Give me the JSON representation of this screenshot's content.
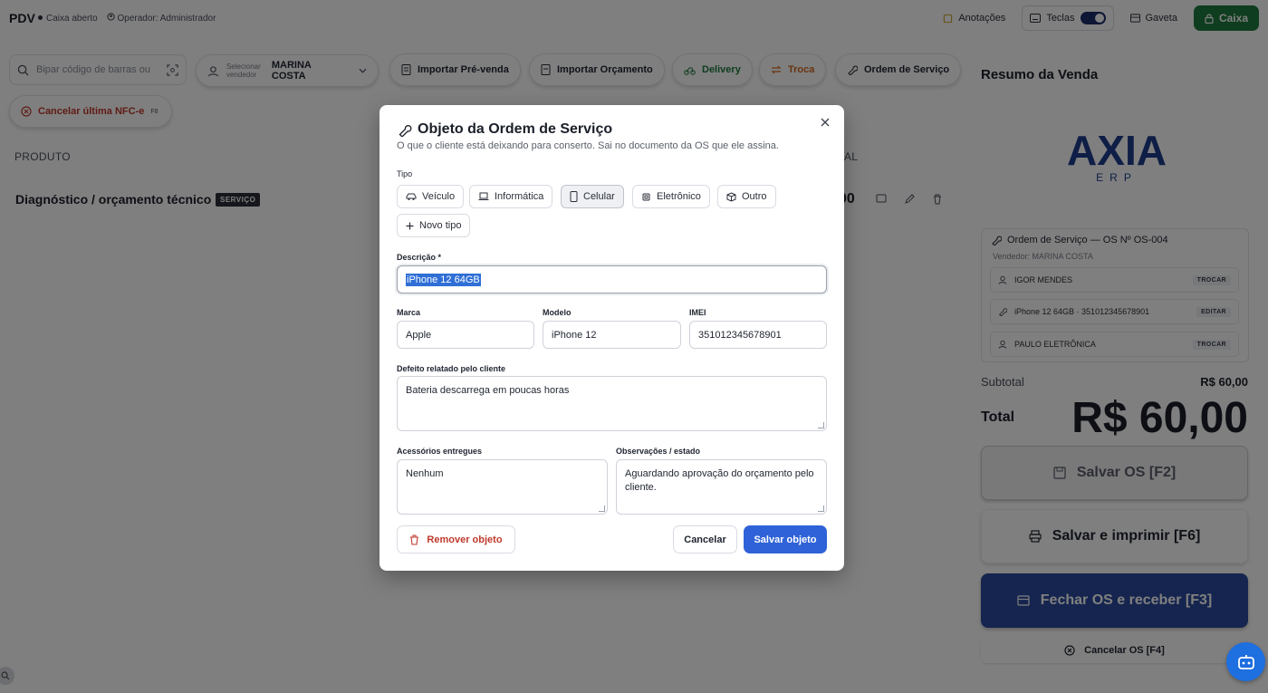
{
  "topbar": {
    "brand": "PDV",
    "status": "Caixa aberto",
    "operator": "Operador: Administrador",
    "notes": "Anotações",
    "keys": "Teclas",
    "drawer": "Gaveta",
    "register": "Caixa"
  },
  "actions": {
    "search_placeholder": "Bipar código de barras ou",
    "seller_label": "Selecionar vendedor",
    "seller_name": "MARINA COSTA",
    "import_presale": "Importar Pré-venda",
    "import_quote": "Importar Orçamento",
    "delivery": "Delivery",
    "exchange": "Troca",
    "service_order": "Ordem de Serviço",
    "cancel_nfce": "Cancelar última NFC-e",
    "cancel_nfce_key": "F8"
  },
  "table": {
    "col_product": "PRODUTO",
    "col_total_partial": "AL",
    "item_name": "Diagnóstico / orçamento técnico",
    "item_badge": "SERVIÇO",
    "item_value_partial": "00"
  },
  "summary": {
    "title": "Resumo da Venda",
    "logo_main": "AXIA",
    "logo_sub": "ERP",
    "os_title": "Ordem de Serviço — OS Nº OS-004",
    "os_seller": "Vendedor: MARINA COSTA",
    "rows": [
      {
        "text": "IGOR MENDES",
        "action": "TROCAR"
      },
      {
        "text": "iPhone 12 64GB · 351012345678901",
        "action": "EDITAR"
      },
      {
        "text": "PAULO ELETRÔNICA",
        "action": "TROCAR"
      }
    ],
    "subtotal_label": "Subtotal",
    "subtotal_value": "R$ 60,00",
    "total_label": "Total",
    "total_value": "R$ 60,00",
    "save_os": "Salvar OS [F2]",
    "save_print": "Salvar e imprimir [F6]",
    "close_os": "Fechar OS e receber [F3]",
    "cancel_os": "Cancelar OS [F4]"
  },
  "modal": {
    "title": "Objeto da Ordem de Serviço",
    "subtitle": "O que o cliente está deixando para conserto. Sai no documento da OS que ele assina.",
    "type_label": "Tipo",
    "types": [
      "Veículo",
      "Informática",
      "Celular",
      "Eletrônico",
      "Outro"
    ],
    "active_type": "Celular",
    "new_type": "Novo tipo",
    "description_label": "Descrição *",
    "description_value": "iPhone 12 64GB",
    "brand_label": "Marca",
    "brand_value": "Apple",
    "model_label": "Modelo",
    "model_value": "iPhone 12",
    "imei_label": "IMEI",
    "imei_value": "351012345678901",
    "defect_label": "Defeito relatado pelo cliente",
    "defect_value": "Bateria descarrega em poucas horas",
    "accessories_label": "Acessórios entregues",
    "accessories_value": "Nenhum",
    "notes_label": "Observações / estado",
    "notes_value": "Aguardando aprovação do orçamento pelo cliente.",
    "remove": "Remover objeto",
    "cancel": "Cancelar",
    "save": "Salvar objeto"
  }
}
